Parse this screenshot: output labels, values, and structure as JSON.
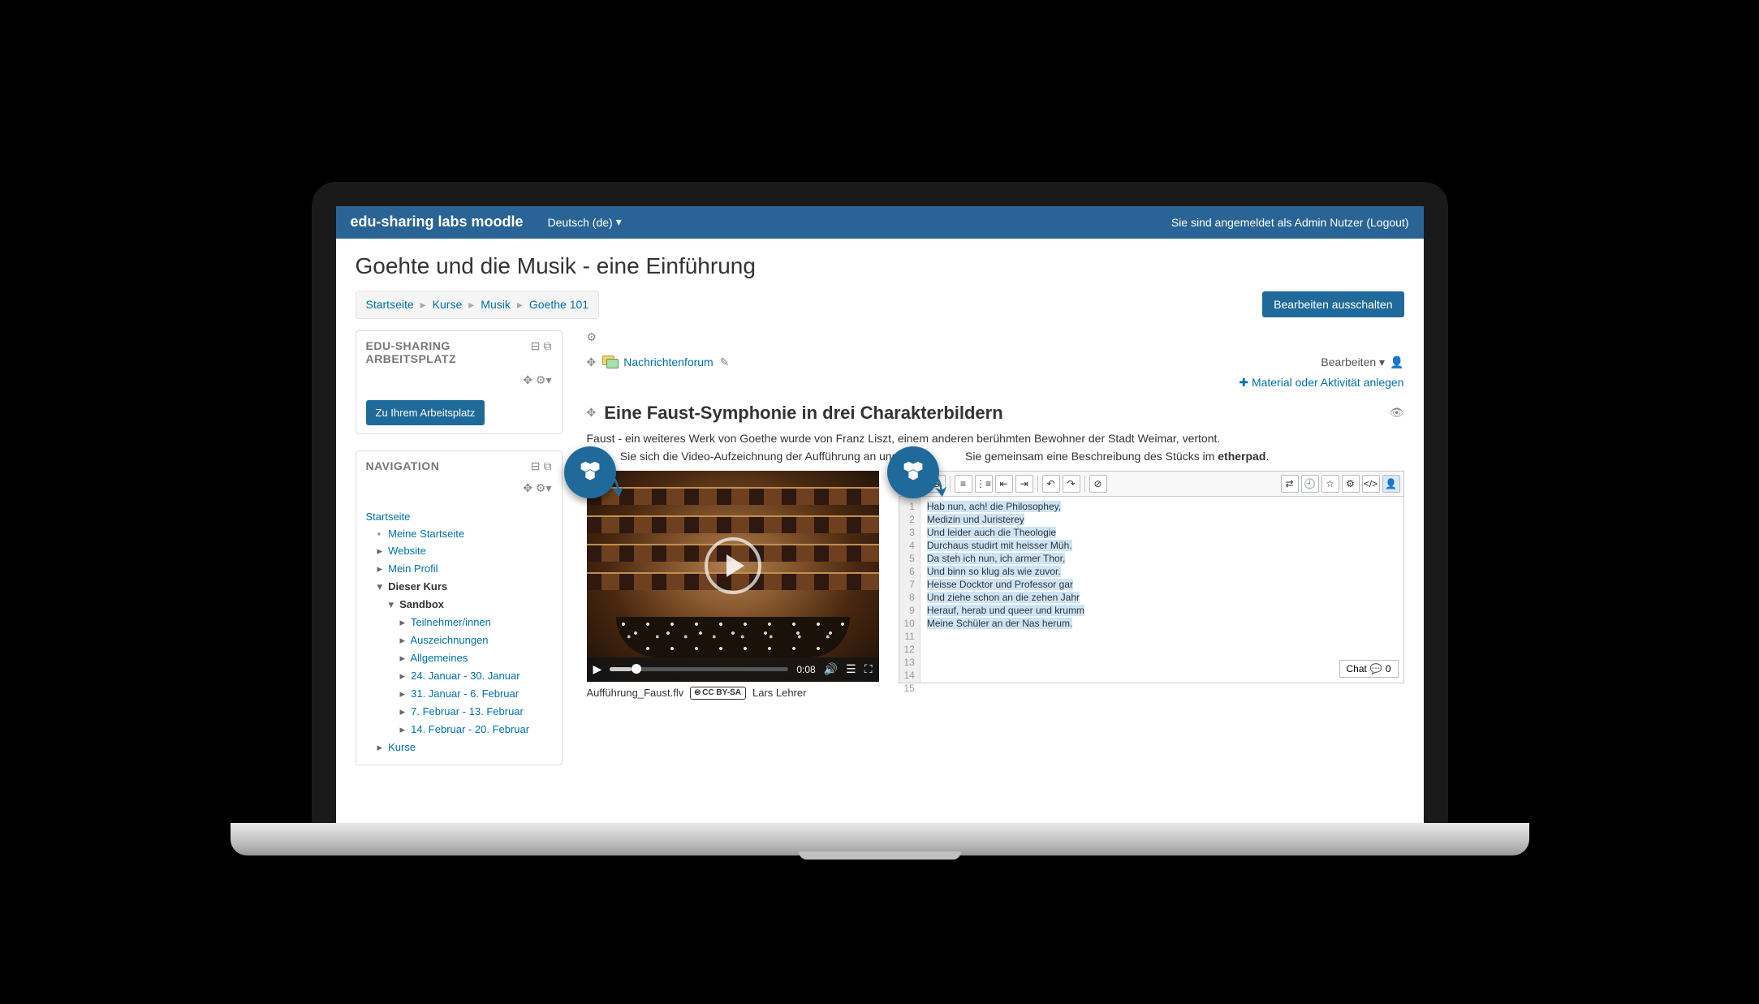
{
  "navbar": {
    "brand": "edu-sharing labs moodle",
    "language": "Deutsch (de)",
    "login_prefix": "Sie sind angemeldet als ",
    "user_name": "Admin Nutzer",
    "logout": "Logout"
  },
  "page": {
    "title": "Goehte und die Musik - eine Einführung"
  },
  "breadcrumb": [
    "Startseite",
    "Kurse",
    "Musik",
    "Goethe 101"
  ],
  "buttons": {
    "toggle_editing": "Bearbeiten ausschalten",
    "workspace": "Zu Ihrem Arbeitsplatz",
    "edit": "Bearbeiten",
    "add_activity": "Material oder Aktivität anlegen",
    "chat": "Chat",
    "chat_count": "0"
  },
  "blocks": {
    "workspace_title": "EDU-SHARING ARBEITSPLATZ",
    "navigation_title": "NAVIGATION"
  },
  "nav": {
    "startseite": "Startseite",
    "meine_startseite": "Meine Startseite",
    "website": "Website",
    "mein_profil": "Mein Profil",
    "dieser_kurs": "Dieser Kurs",
    "sandbox": "Sandbox",
    "teilnehmer": "Teilnehmer/innen",
    "auszeichnungen": "Auszeichnungen",
    "allgemeines": "Allgemeines",
    "week1": "24. Januar - 30. Januar",
    "week2": "31. Januar - 6. Februar",
    "week3": "7. Februar - 13. Februar",
    "week4": "14. Februar - 20. Februar",
    "kurse": "Kurse"
  },
  "activity": {
    "forum_link": "Nachrichtenforum"
  },
  "section": {
    "title": "Eine Faust-Symphonie in drei Charakterbildern",
    "para1": "Faust - ein weiteres Werk von Goethe wurde von Franz Liszt, einem anderen berühmten Bewohner der Stadt Weimar, vertont.",
    "para2_a": "Sie sich die Video-Aufzeichnung der Aufführung an und ve",
    "para2_b": "Sie gemeinsam eine Beschreibung des Stücks im ",
    "para2_bold": "etherpad"
  },
  "video": {
    "time": "0:08",
    "filename": "Aufführung_Faust.flv",
    "license": "CC BY-SA",
    "author": "Lars Lehrer"
  },
  "editor": {
    "lines": [
      "Hab nun, ach! die Philosophey,",
      "Medizin und Juristerey",
      "Und leider auch die Theologie",
      "Durchaus studirt mit heisser Müh.",
      "Da steh ich nun, ich armer Thor,",
      "Und binn so klug als wie zuvor.",
      "Heisse Docktor und Professor gar",
      "Und ziehe schon an die zehen Jahr",
      "Herauf, herab und queer und krumm",
      "Meine Schüler an der Nas herum."
    ],
    "line_count": 15
  }
}
